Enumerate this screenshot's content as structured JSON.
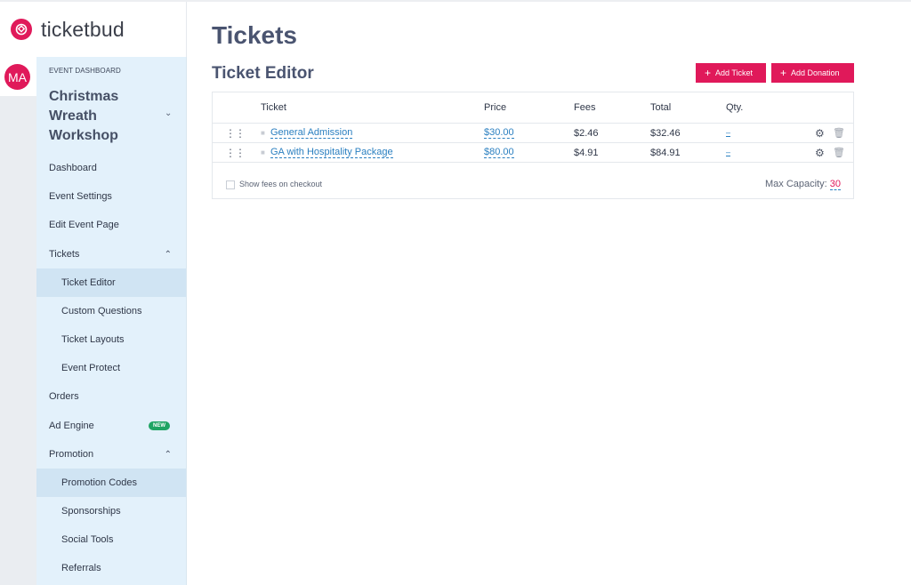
{
  "app": {
    "brand": "ticketbud",
    "brand_color": "#e0195a"
  },
  "user": {
    "initials": "MA"
  },
  "sidebar": {
    "section_label": "EVENT DASHBOARD",
    "event_name": "Christmas Wreath Workshop",
    "items": [
      {
        "label": "Dashboard"
      },
      {
        "label": "Event Settings"
      },
      {
        "label": "Edit Event Page"
      },
      {
        "label": "Tickets",
        "expanded": true
      },
      {
        "label": "Ticket Editor",
        "active": true
      },
      {
        "label": "Custom Questions"
      },
      {
        "label": "Ticket Layouts"
      },
      {
        "label": "Event Protect"
      },
      {
        "label": "Orders"
      },
      {
        "label": "Ad Engine",
        "badge": "NEW"
      },
      {
        "label": "Promotion",
        "expanded": true
      },
      {
        "label": "Promotion Codes",
        "highlighted": true
      },
      {
        "label": "Sponsorships"
      },
      {
        "label": "Social Tools"
      },
      {
        "label": "Referrals"
      }
    ]
  },
  "main": {
    "page_title": "Tickets",
    "section_title": "Ticket Editor",
    "buttons": {
      "add_ticket": "Add Ticket",
      "add_donation": "Add Donation"
    },
    "table": {
      "headers": {
        "ticket": "Ticket",
        "price": "Price",
        "fees": "Fees",
        "total": "Total",
        "qty": "Qty."
      },
      "rows": [
        {
          "name": "General Admission",
          "price": "$30.00",
          "fees": "$2.46",
          "total": "$32.46",
          "qty": "–"
        },
        {
          "name": "GA with Hospitality Package",
          "price": "$80.00",
          "fees": "$4.91",
          "total": "$84.91",
          "qty": "–"
        }
      ]
    },
    "footer": {
      "show_fees_label": "Show fees on checkout",
      "show_fees_checked": false,
      "max_capacity_label": "Max Capacity:",
      "max_capacity_value": "30"
    }
  }
}
